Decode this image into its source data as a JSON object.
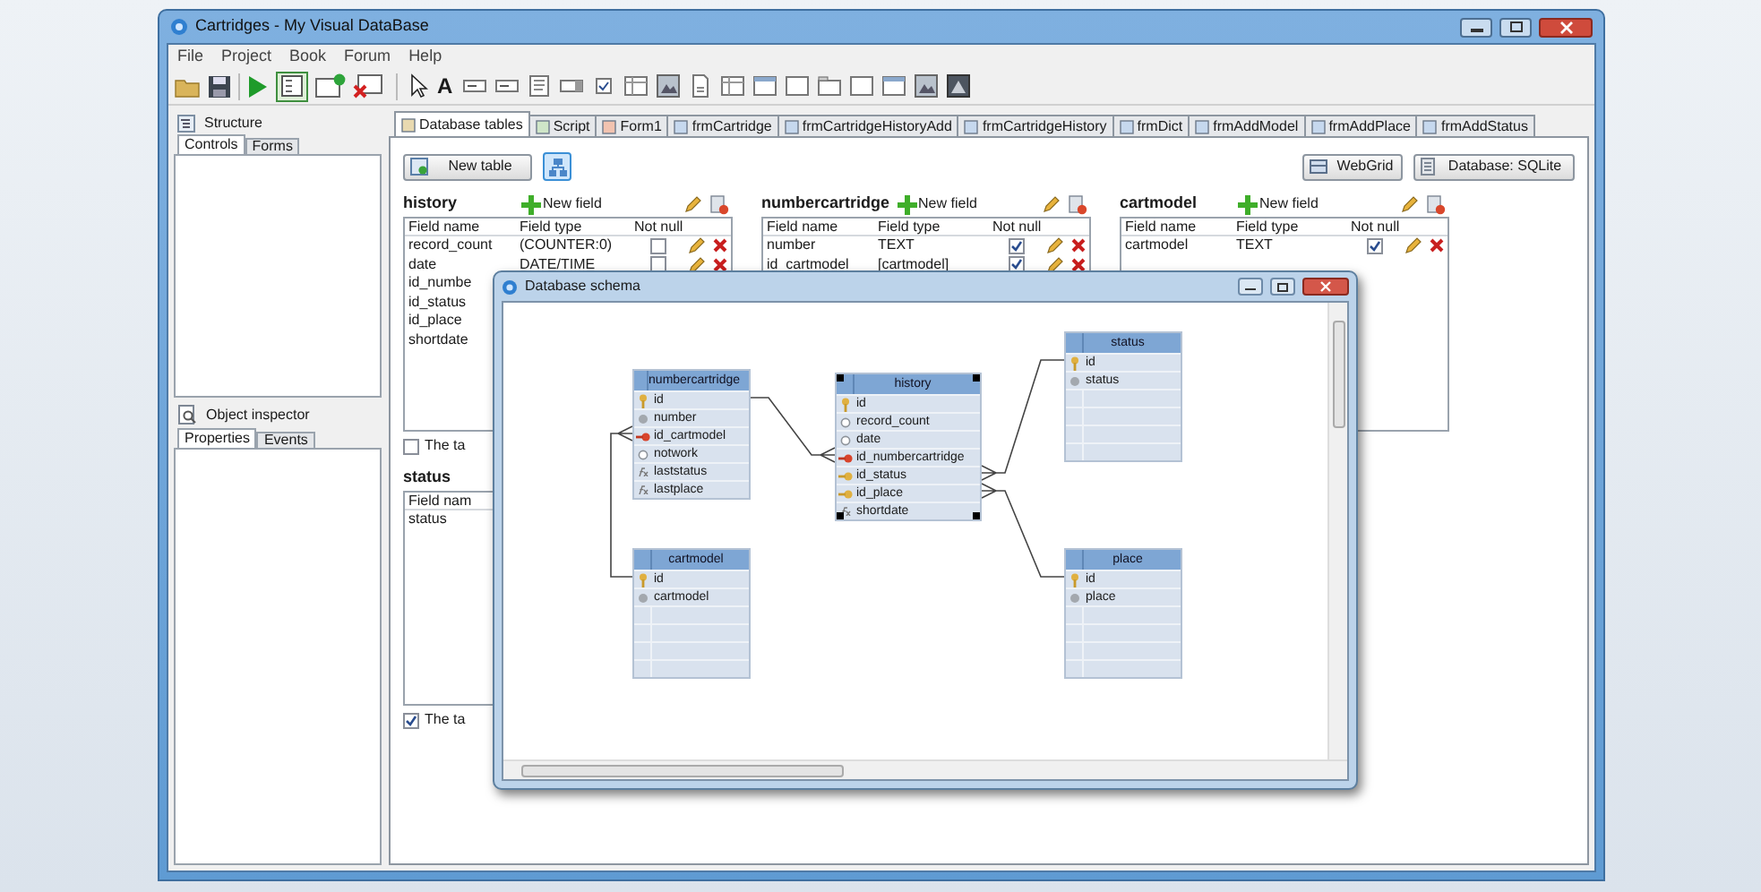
{
  "window": {
    "title": "Cartridges - My Visual DataBase"
  },
  "menu": [
    "File",
    "Project",
    "Book",
    "Forum",
    "Help"
  ],
  "toolbar": {
    "text_tool": "A"
  },
  "structure_panel": {
    "title": "Structure",
    "tabs": [
      {
        "label": "Controls",
        "selected": true
      },
      {
        "label": "Forms",
        "selected": false
      }
    ]
  },
  "inspector_panel": {
    "title": "Object inspector",
    "tabs": [
      {
        "label": "Properties",
        "selected": true
      },
      {
        "label": "Events",
        "selected": false
      }
    ]
  },
  "tabs": [
    {
      "label": "Database tables",
      "selected": true
    },
    {
      "label": "Script",
      "selected": false
    },
    {
      "label": "Form1",
      "selected": false
    },
    {
      "label": "frmCartridge",
      "selected": false
    },
    {
      "label": "frmCartridgeHistoryAdd",
      "selected": false
    },
    {
      "label": "frmCartridgeHistory",
      "selected": false
    },
    {
      "label": "frmDict",
      "selected": false
    },
    {
      "label": "frmAddModel",
      "selected": false
    },
    {
      "label": "frmAddPlace",
      "selected": false
    },
    {
      "label": "frmAddStatus",
      "selected": false
    }
  ],
  "buttons": {
    "new_table": "New table",
    "schema_on": true,
    "webgrid": "WebGrid",
    "database": "Database: SQLite"
  },
  "tables": [
    {
      "name": "history",
      "new_field": "New field",
      "columns": [
        "Field name",
        "Field type",
        "Not null"
      ],
      "rows": [
        {
          "name": "record_count",
          "type": "(COUNTER:0)",
          "not_null": false
        },
        {
          "name": "date",
          "type": "DATE/TIME",
          "not_null": false
        },
        {
          "name": "id_numbe"
        },
        {
          "name": "id_status"
        },
        {
          "name": "id_place"
        },
        {
          "name": "shortdate"
        }
      ],
      "footer": {
        "label": "The ta",
        "checked": false
      }
    },
    {
      "name": "numbercartridge",
      "new_field": "New field",
      "columns": [
        "Field name",
        "Field type",
        "Not null"
      ],
      "rows": [
        {
          "name": "number",
          "type": "TEXT",
          "not_null": true
        },
        {
          "name": "id_cartmodel",
          "type": "[cartmodel]",
          "not_null": true
        }
      ]
    },
    {
      "name": "cartmodel",
      "new_field": "New field",
      "columns": [
        "Field name",
        "Field type",
        "Not null"
      ],
      "rows": [
        {
          "name": "cartmodel",
          "type": "TEXT",
          "not_null": true
        }
      ]
    },
    {
      "name": "status",
      "columns": [
        "Field nam"
      ],
      "rows": [
        {
          "name": "status"
        }
      ],
      "footer": {
        "label": "The ta",
        "checked": true
      }
    }
  ],
  "schema_dialog": {
    "title": "Database schema",
    "entities": [
      {
        "name": "numbercartridge",
        "selected": false,
        "fields": [
          {
            "name": "id",
            "kind": "pk"
          },
          {
            "name": "number",
            "kind": "required"
          },
          {
            "name": "id_cartmodel",
            "kind": "fk"
          },
          {
            "name": "notwork",
            "kind": "optional"
          },
          {
            "name": "laststatus",
            "kind": "calc"
          },
          {
            "name": "lastplace",
            "kind": "calc"
          }
        ]
      },
      {
        "name": "history",
        "selected": true,
        "fields": [
          {
            "name": "id",
            "kind": "pk"
          },
          {
            "name": "record_count",
            "kind": "optional"
          },
          {
            "name": "date",
            "kind": "optional"
          },
          {
            "name": "id_numbercartridge",
            "kind": "fk"
          },
          {
            "name": "id_status",
            "kind": "ref"
          },
          {
            "name": "id_place",
            "kind": "ref"
          },
          {
            "name": "shortdate",
            "kind": "calc"
          }
        ]
      },
      {
        "name": "status",
        "selected": false,
        "fields": [
          {
            "name": "id",
            "kind": "pk"
          },
          {
            "name": "status",
            "kind": "required"
          }
        ]
      },
      {
        "name": "cartmodel",
        "selected": false,
        "fields": [
          {
            "name": "id",
            "kind": "pk"
          },
          {
            "name": "cartmodel",
            "kind": "required"
          }
        ]
      },
      {
        "name": "place",
        "selected": false,
        "fields": [
          {
            "name": "id",
            "kind": "pk"
          },
          {
            "name": "place",
            "kind": "required"
          }
        ]
      }
    ]
  }
}
